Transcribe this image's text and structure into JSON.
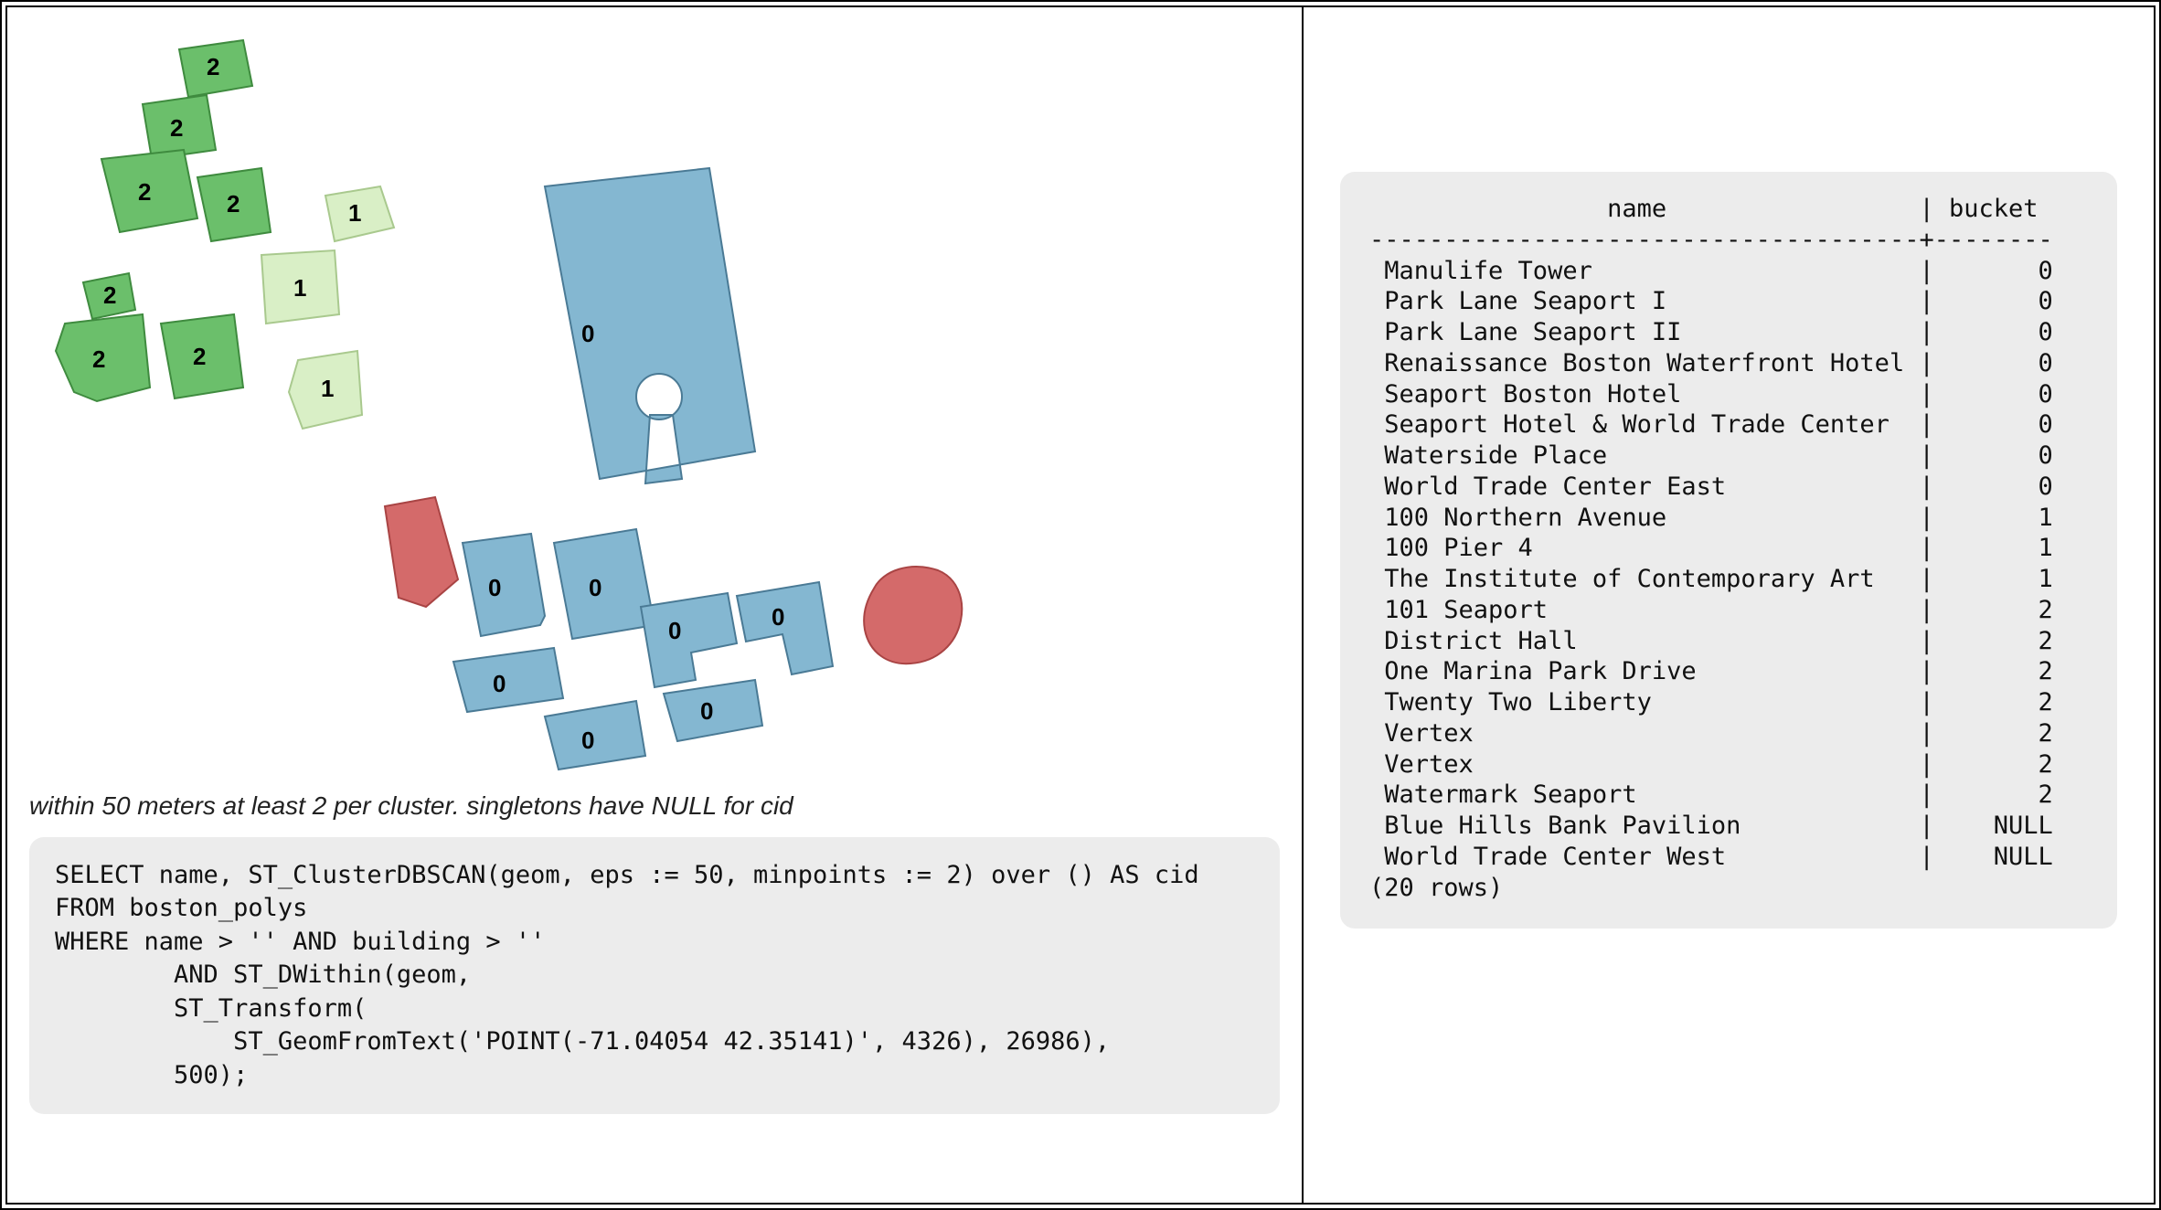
{
  "caption": "within 50 meters at least 2 per cluster. singletons have NULL for cid",
  "sql": "SELECT name, ST_ClusterDBSCAN(geom, eps := 50, minpoints := 2) over () AS cid\nFROM boston_polys\nWHERE name > '' AND building > ''\n        AND ST_DWithin(geom,\n        ST_Transform(\n            ST_GeomFromText('POINT(-71.04054 42.35141)', 4326), 26986),\n        500);",
  "result_header": [
    "name",
    "bucket"
  ],
  "result_rows": [
    [
      "Manulife Tower",
      "0"
    ],
    [
      "Park Lane Seaport I",
      "0"
    ],
    [
      "Park Lane Seaport II",
      "0"
    ],
    [
      "Renaissance Boston Waterfront Hotel",
      "0"
    ],
    [
      "Seaport Boston Hotel",
      "0"
    ],
    [
      "Seaport Hotel & World Trade Center",
      "0"
    ],
    [
      "Waterside Place",
      "0"
    ],
    [
      "World Trade Center East",
      "0"
    ],
    [
      "100 Northern Avenue",
      "1"
    ],
    [
      "100 Pier 4",
      "1"
    ],
    [
      "The Institute of Contemporary Art",
      "1"
    ],
    [
      "101 Seaport",
      "2"
    ],
    [
      "District Hall",
      "2"
    ],
    [
      "One Marina Park Drive",
      "2"
    ],
    [
      "Twenty Two Liberty",
      "2"
    ],
    [
      "Vertex",
      "2"
    ],
    [
      "Vertex",
      "2"
    ],
    [
      "Watermark Seaport",
      "2"
    ],
    [
      "Blue Hills Bank Pavilion",
      "NULL"
    ],
    [
      "World Trade Center West",
      "NULL"
    ]
  ],
  "result_rowcount": "(20 rows)",
  "colors": {
    "cluster0_fill": "#84b7d1",
    "cluster0_stroke": "#4a7a95",
    "cluster1_fill": "#d9efc6",
    "cluster1_stroke": "#a9c98e",
    "cluster2_fill": "#6bbf6b",
    "cluster2_stroke": "#3f8b3f",
    "noise_fill": "#d46a6a",
    "noise_stroke": "#a94444"
  },
  "map_clusters": {
    "cluster2_labels": [
      "2",
      "2",
      "2",
      "2",
      "2",
      "2",
      "2"
    ],
    "cluster1_labels": [
      "1",
      "1",
      "1"
    ],
    "cluster0_labels": [
      "0",
      "0",
      "0",
      "0",
      "0",
      "0",
      "0",
      "0"
    ]
  }
}
